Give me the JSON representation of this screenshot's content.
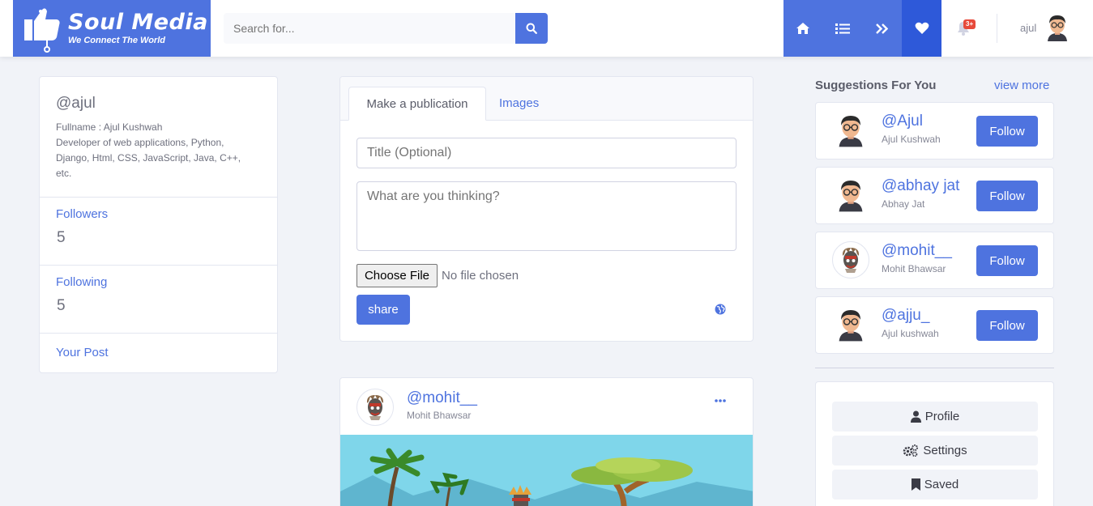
{
  "brand": {
    "name": "Soul Media",
    "tagline": "We Connect The World"
  },
  "search": {
    "placeholder": "Search for..."
  },
  "nav": {
    "notification_count": "3+",
    "username": "ajul"
  },
  "profile": {
    "handle": "@ajul",
    "fullname_line": "Fullname : Ajul Kushwah",
    "bio": "Developer of web applications, Python, Django, Html, CSS, JavaScript, Java, C++, etc.",
    "followers_label": "Followers",
    "followers_count": "5",
    "following_label": "Following",
    "following_count": "5",
    "your_post_label": "Your Post"
  },
  "publication": {
    "tab_active": "Make a publication",
    "tab_images": "Images",
    "title_placeholder": "Title (Optional)",
    "body_placeholder": "What are you thinking?",
    "file_button": "Choose File",
    "file_status": "No file chosen",
    "share_label": "share"
  },
  "post": {
    "handle": "@mohit__",
    "name": "Mohit Bhawsar"
  },
  "suggestions": {
    "title": "Suggestions For You",
    "view_more": "view more",
    "items": [
      {
        "handle": "@Ajul",
        "name": "Ajul Kushwah",
        "follow": "Follow"
      },
      {
        "handle": "@abhay jat",
        "name": "Abhay Jat",
        "follow": "Follow"
      },
      {
        "handle": "@mohit__",
        "name": "Mohit Bhawsar",
        "follow": "Follow"
      },
      {
        "handle": "@ajju_",
        "name": "Ajul kushwah",
        "follow": "Follow"
      }
    ]
  },
  "menu": {
    "profile": "Profile",
    "settings": "Settings",
    "saved": "Saved"
  },
  "colors": {
    "primary": "#4e73df",
    "primary_dark": "#2e59d9",
    "background": "#f1f3f8",
    "badge": "#e74a3b"
  }
}
